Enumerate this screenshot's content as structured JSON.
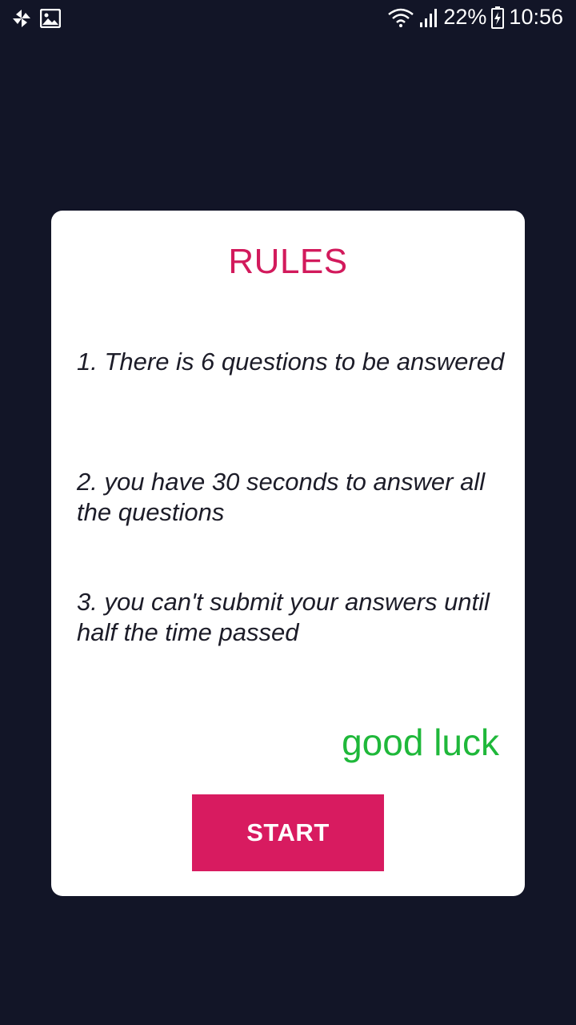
{
  "status_bar": {
    "battery_percent": "22%",
    "time": "10:56",
    "icons": [
      "pinwheel-icon",
      "image-icon",
      "wifi-icon",
      "signal-icon",
      "battery-icon"
    ]
  },
  "card": {
    "title": "RULES",
    "rules": [
      "1. There is 6 questions to be answered",
      "2. you have 30 seconds to answer all the questions",
      "3. you can't submit your answers until half the time passed"
    ],
    "closing": "good luck",
    "start_label": "START"
  },
  "colors": {
    "background": "#121527",
    "card": "#ffffff",
    "title": "#d21a5c",
    "good_luck": "#1fb83a",
    "button": "#d81b60"
  }
}
